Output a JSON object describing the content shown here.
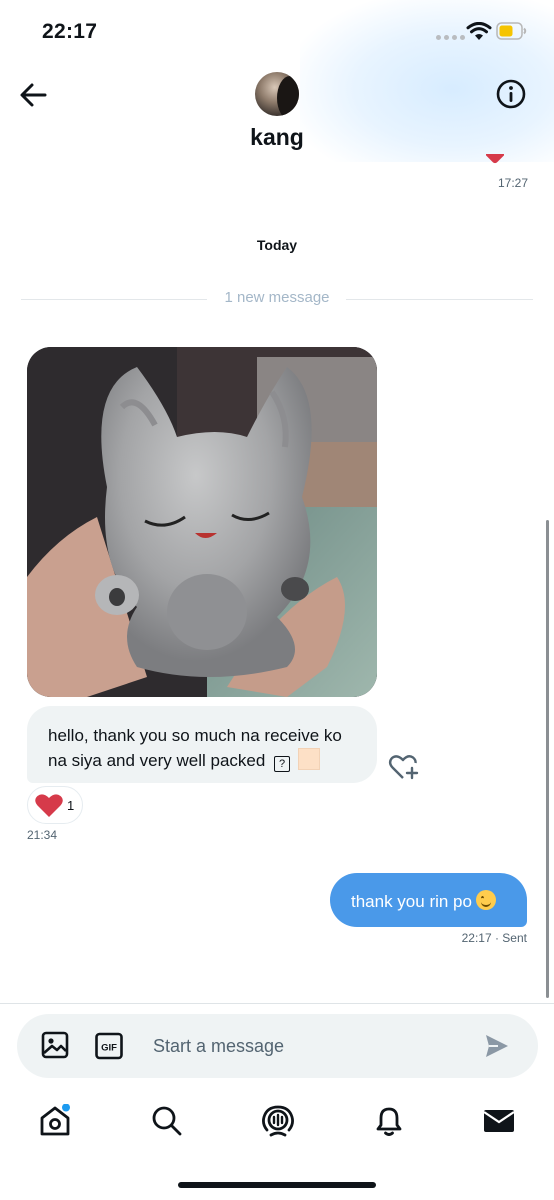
{
  "status_bar": {
    "time": "22:17"
  },
  "header": {
    "contact_name": "kang"
  },
  "history": {
    "previous_time": "17:27"
  },
  "thread": {
    "day_label": "Today",
    "new_message_divider": "1 new message",
    "incoming": {
      "text": "hello, thank you so much na receive ko na siya and very well packed",
      "unknown_glyph": "?",
      "reaction_count": "1",
      "time": "21:34"
    },
    "outgoing": {
      "text": "thank you rin po",
      "time": "22:17",
      "status": "Sent",
      "time_status": "22:17 · Sent"
    }
  },
  "composer": {
    "placeholder": "Start a message",
    "gif_label": "GIF"
  },
  "icons": {
    "back": "arrow-left-icon",
    "info": "info-icon",
    "media": "image-icon",
    "gif": "gif-icon",
    "send": "send-icon",
    "add_reaction": "heart-plus-icon",
    "tabs": [
      "home-icon",
      "search-icon",
      "spaces-icon",
      "notifications-icon",
      "messages-icon"
    ]
  },
  "colors": {
    "outgoing_bubble": "#4a99e9",
    "incoming_bubble": "#eff3f4",
    "reaction_heart": "#d63a4a",
    "notification_dot": "#1d9bf0"
  }
}
